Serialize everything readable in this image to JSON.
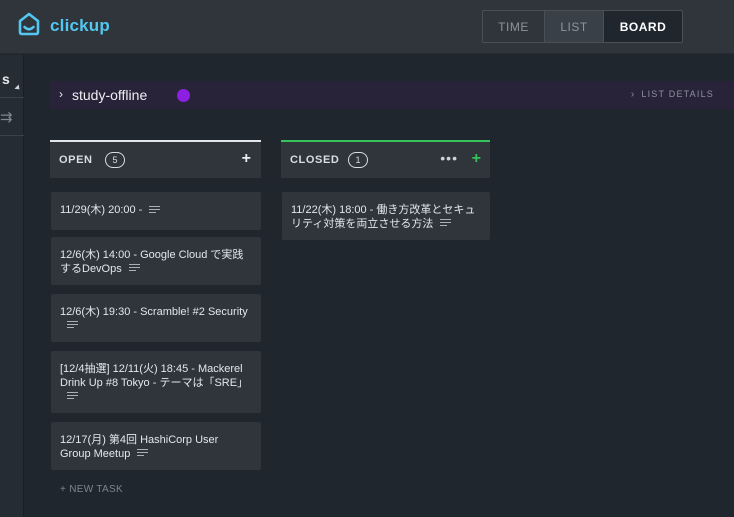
{
  "app": {
    "logo_text": "clickup",
    "brand_color": "#53c7f0"
  },
  "views": {
    "time": "TIME",
    "list": "LIST",
    "board": "BOARD",
    "active": "BOARD"
  },
  "left_strip": {
    "letter": "s",
    "icon": "arrows-icon"
  },
  "list_header": {
    "chevron": "›",
    "title": "study-offline",
    "dot_color": "#8d1fe3",
    "details_label": "LIST DETAILS",
    "details_chevron": "›"
  },
  "columns": {
    "open": {
      "label": "OPEN",
      "count": "5",
      "accent_color": "#e3e6e9",
      "add": "+",
      "tasks": [
        {
          "title": "11/29(木) 20:00 -"
        },
        {
          "title": "12/6(木) 14:00 - Google Cloud で実践するDevOps"
        },
        {
          "title": "12/6(木) 19:30 - Scramble! #2 Security"
        },
        {
          "title": "[12/4抽選] 12/11(火) 18:45 - Mackerel Drink Up #8 Tokyo - テーマは「SRE」"
        },
        {
          "title": "12/17(月) 第4回 HashiCorp User Group Meetup"
        }
      ],
      "new_task": "+ NEW TASK"
    },
    "closed": {
      "label": "CLOSED",
      "count": "1",
      "accent_color": "#36c15b",
      "more": "•••",
      "add": "+",
      "tasks": [
        {
          "title": "11/22(木) 18:00 - 働き方改革とセキュリティ対策を両立させる方法"
        }
      ]
    }
  }
}
